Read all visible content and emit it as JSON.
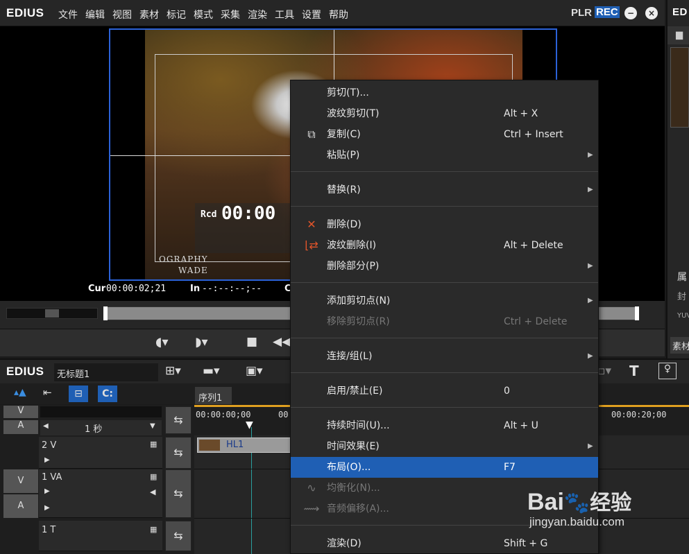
{
  "app": {
    "logo": "EDIUS"
  },
  "menubar": [
    "文件",
    "编辑",
    "视图",
    "素材",
    "标记",
    "模式",
    "采集",
    "渲染",
    "工具",
    "设置",
    "帮助"
  ],
  "player": {
    "plr": "PLR",
    "rec": "REC",
    "minimize": "−",
    "close": "×"
  },
  "preview": {
    "cur_label": "Cur",
    "cur_tc": "00:00:02;21",
    "in_label": "In",
    "in_tc": "--:--:--;--",
    "c_label": "C",
    "rcd_label": "Rcd",
    "rcd_tc": "00:00",
    "watermark_1": "OGRAPHY",
    "watermark_2": "WADE"
  },
  "right_panel": {
    "logo": "ED",
    "props": "属",
    "cover": "封",
    "yuv": "YUV",
    "material": "素材"
  },
  "timeline": {
    "logo": "EDIUS",
    "project": "无标题1",
    "sequence_tab": "序列1",
    "scale": "1 秒",
    "ruler": [
      "00:00:00;00",
      "00",
      "00:00:20;00"
    ],
    "tracks": [
      {
        "name": "2 V",
        "clip": "HL1"
      },
      {
        "name": "1 VA",
        "v_btn": "V",
        "a_btn": "A"
      },
      {
        "name": "1 T"
      }
    ],
    "top_v": "V",
    "top_a": "A"
  },
  "context_menu": {
    "items": [
      {
        "label": "剪切(T)...",
        "shortcut": "",
        "icon": "",
        "submenu": false,
        "disabled": false,
        "selected": false
      },
      {
        "label": "波纹剪切(T)",
        "shortcut": "Alt + X",
        "icon": "",
        "submenu": false,
        "disabled": false,
        "selected": false
      },
      {
        "label": "复制(C)",
        "shortcut": "Ctrl + Insert",
        "icon": "copy-icon",
        "submenu": false,
        "disabled": false,
        "selected": false
      },
      {
        "label": "粘贴(P)",
        "shortcut": "",
        "icon": "",
        "submenu": true,
        "disabled": false,
        "selected": false
      },
      {
        "label": "替换(R)",
        "shortcut": "",
        "icon": "",
        "submenu": true,
        "disabled": false,
        "selected": false
      },
      {
        "label": "删除(D)",
        "shortcut": "",
        "icon": "delete-icon",
        "submenu": false,
        "disabled": false,
        "selected": false
      },
      {
        "label": "波纹删除(I)",
        "shortcut": "Alt + Delete",
        "icon": "ripple-delete-icon",
        "submenu": false,
        "disabled": false,
        "selected": false
      },
      {
        "label": "删除部分(P)",
        "shortcut": "",
        "icon": "",
        "submenu": true,
        "disabled": false,
        "selected": false
      },
      {
        "label": "添加剪切点(N)",
        "shortcut": "",
        "icon": "",
        "submenu": true,
        "disabled": false,
        "selected": false
      },
      {
        "label": "移除剪切点(R)",
        "shortcut": "Ctrl + Delete",
        "icon": "",
        "submenu": false,
        "disabled": true,
        "selected": false
      },
      {
        "label": "连接/组(L)",
        "shortcut": "",
        "icon": "",
        "submenu": true,
        "disabled": false,
        "selected": false
      },
      {
        "label": "启用/禁止(E)",
        "shortcut": "0",
        "icon": "",
        "submenu": false,
        "disabled": false,
        "selected": false
      },
      {
        "label": "持续时间(U)...",
        "shortcut": "Alt + U",
        "icon": "",
        "submenu": false,
        "disabled": false,
        "selected": false
      },
      {
        "label": "时间效果(E)",
        "shortcut": "",
        "icon": "",
        "submenu": true,
        "disabled": false,
        "selected": false
      },
      {
        "label": "布局(O)...",
        "shortcut": "F7",
        "icon": "",
        "submenu": false,
        "disabled": false,
        "selected": true
      },
      {
        "label": "均衡化(N)...",
        "shortcut": "",
        "icon": "normalize-icon",
        "submenu": false,
        "disabled": true,
        "selected": false
      },
      {
        "label": "音频偏移(A)...",
        "shortcut": "",
        "icon": "audio-offset-icon",
        "submenu": false,
        "disabled": true,
        "selected": false
      },
      {
        "label": "渲染(D)",
        "shortcut": "Shift + G",
        "icon": "",
        "submenu": false,
        "disabled": false,
        "selected": false
      }
    ]
  },
  "watermark": {
    "brand": "Bai",
    "brand2": "经验",
    "url": "jingyan.baidu.com"
  },
  "colors": {
    "accent": "#1f5fb4",
    "delete": "#e0542a"
  }
}
